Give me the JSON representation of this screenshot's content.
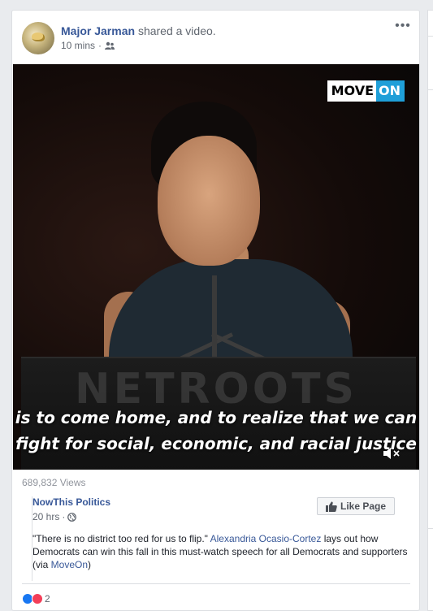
{
  "post": {
    "author": "Major Jarman",
    "action": "shared a video.",
    "time": "10 mins",
    "more": "•••"
  },
  "video": {
    "logo_left": "MOVE",
    "logo_right": "ON",
    "podium_text": "NETROOTS",
    "caption_line1": "is to come home, and to realize that we can",
    "caption_line2": "fight for social, economic, and racial justice"
  },
  "stats": {
    "views": "689,832 Views"
  },
  "shared": {
    "page_name": "NowThis Politics",
    "time": "20 hrs",
    "like_page_label": "Like Page",
    "desc_part1": "\"There is no district too red for us to flip.\" ",
    "desc_link1": "Alexandria Ocasio-Cortez",
    "desc_part2": " lays out how Democrats can win this fall in this must-watch speech for all Democrats and supporters (via ",
    "desc_link2": "MoveOn",
    "desc_part3": ")"
  },
  "reactions": {
    "count": "2",
    "like_color": "#1877f2",
    "love_color": "#f33e58"
  },
  "colors": {
    "link": "#385898",
    "meta": "#616770",
    "background": "#e9ebee"
  }
}
